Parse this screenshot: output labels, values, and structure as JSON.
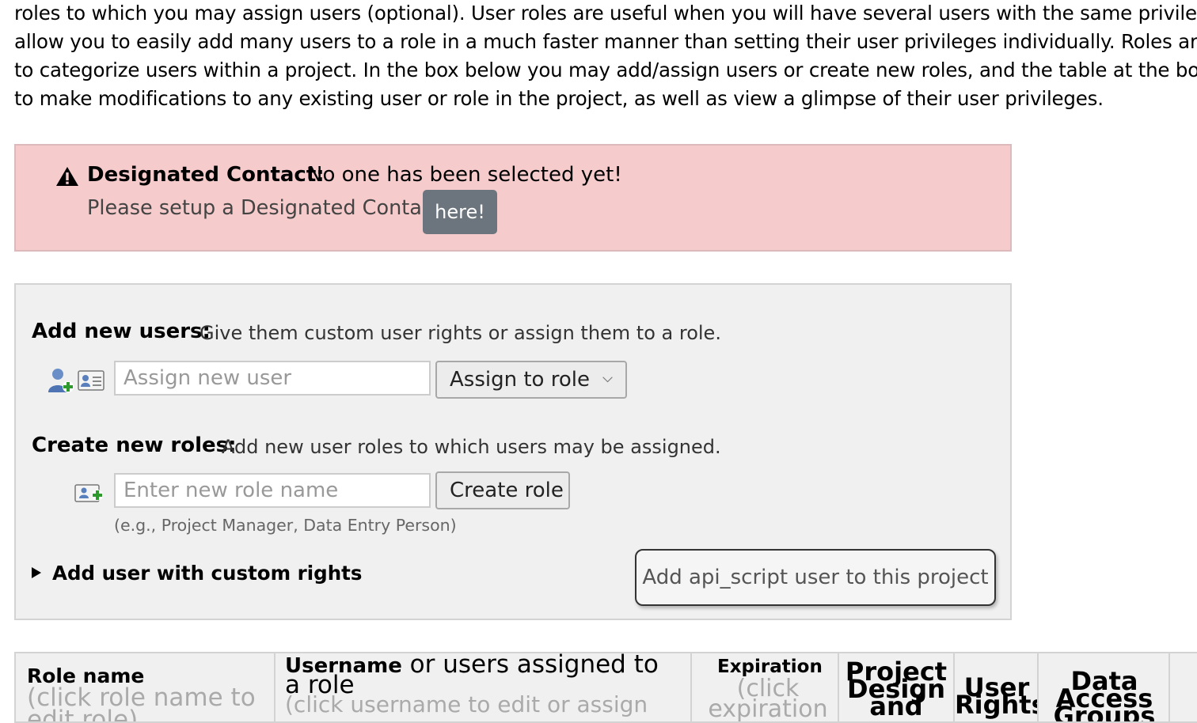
{
  "intro": {
    "lines": [
      "roles to which you may assign users (optional). User roles are useful when you will have several users with the same privileges",
      "allow you to easily add many users to a role in a much faster manner than setting their user privileges individually. Roles are",
      "to categorize users within a project. In the box below you may add/assign users or create new roles, and the table at the bottom",
      "to make modifications to any existing user or role in the project, as well as view a glimpse of their user privileges."
    ]
  },
  "designated_contact": {
    "icon": "warning-icon",
    "title": "Designated Contact:",
    "message": "No one has been selected yet!",
    "setup_text": "Please setup a Designated Contact",
    "button_label": "here!"
  },
  "add_users": {
    "label": "Add new users:",
    "description": "Give them custom user rights or assign them to a role.",
    "icons": [
      "add-user-icon",
      "user-card-icon"
    ],
    "input_placeholder": "Assign new user",
    "input_value": "",
    "role_button_label": "Assign to role",
    "role_button_icon": "chevron-down-icon"
  },
  "create_roles": {
    "label": "Create new roles:",
    "description": "Add new user roles to which users may be assigned.",
    "icon": "add-role-icon",
    "input_placeholder": "Enter new role name",
    "input_value": "",
    "button_label": "Create role",
    "hint": "(e.g., Project Manager, Data Entry Person)"
  },
  "custom_rights": {
    "toggle_label": "Add user with custom rights"
  },
  "api_button": {
    "label": "Add api_script user to this project"
  },
  "table": {
    "columns": {
      "role": {
        "title": "Role name",
        "subtitle": "(click role name to edit role)"
      },
      "username": {
        "title_bold": "Username",
        "title_rest": " or users assigned to a role",
        "subtitle": "(click username to edit or assign"
      },
      "expiration": {
        "title": "Expiration",
        "subtitle": "(click expiration"
      },
      "project_design": {
        "title": "Project Design and"
      },
      "user_rights": {
        "title": "User Rights"
      },
      "dag": {
        "title": "Data Access Groups"
      }
    }
  },
  "colors": {
    "alert_bg": "#f6cbcc",
    "panel_bg": "#f0f0f0",
    "here_button": "#6c757d"
  }
}
